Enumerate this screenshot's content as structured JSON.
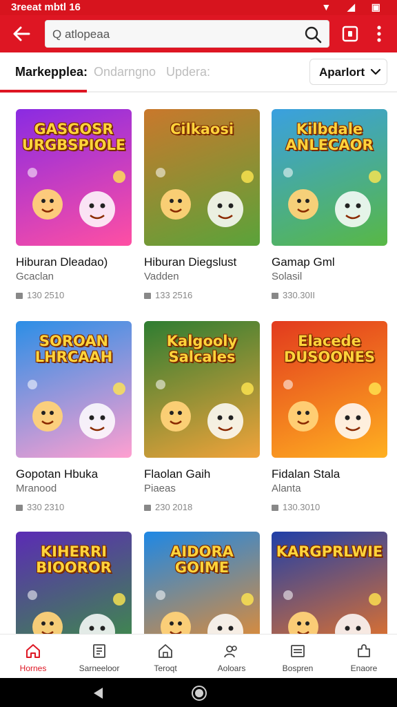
{
  "status_bar": {
    "time": "3reeat mbtl 16",
    "icons": "▼ ◢ ▣"
  },
  "search": {
    "value": "",
    "placeholder": "Q atlopeaa"
  },
  "tabs": [
    {
      "label": "Markepplea:",
      "active": true
    },
    {
      "label": "Ondarngno",
      "active": false
    },
    {
      "label": "Updera:",
      "active": false
    }
  ],
  "sort": {
    "label": "Aparlort"
  },
  "games": [
    {
      "art_title": "GASGOSR URGBSPIOLE",
      "title": "Hiburan Dleadao)",
      "subtitle": "Gcaclan",
      "meta": "130 2510",
      "palette": [
        "#8a2be2",
        "#ff4fa3"
      ]
    },
    {
      "art_title": "Cilkaosi",
      "title": "Hiburan Diegslust",
      "subtitle": "Vadden",
      "meta": "133 2516",
      "palette": [
        "#c9782c",
        "#5aa33a"
      ]
    },
    {
      "art_title": "Kilbdale ANLECAOR",
      "title": "Gamap Gml",
      "subtitle": "Solasil",
      "meta": "330.30II",
      "palette": [
        "#3aa0e0",
        "#58b845"
      ]
    },
    {
      "art_title": "SOROAN LHRCAAH",
      "title": "Gopotan Hbuka",
      "subtitle": "Mranood",
      "meta": "330 2310",
      "palette": [
        "#2b8ee6",
        "#ff9fd0"
      ]
    },
    {
      "art_title": "Kalgooly Salcales",
      "title": "Flaolan Gaih",
      "subtitle": "Piaeas",
      "meta": "230 2018",
      "palette": [
        "#2e7d32",
        "#f2a33a"
      ]
    },
    {
      "art_title": "Elacede DUSOONES",
      "title": "Fidalan Stala",
      "subtitle": "Alanta",
      "meta": "130.3010",
      "palette": [
        "#e23a1e",
        "#ffb020"
      ]
    },
    {
      "art_title": "KIHERRI BIOOROR",
      "title": "",
      "subtitle": "",
      "meta": "",
      "palette": [
        "#5b2bb5",
        "#3a9a3a"
      ]
    },
    {
      "art_title": "AIDORA GOIME",
      "title": "",
      "subtitle": "",
      "meta": "",
      "palette": [
        "#1e88e5",
        "#ff8c1a"
      ]
    },
    {
      "art_title": "KARGPRLWIE",
      "title": "",
      "subtitle": "",
      "meta": "",
      "palette": [
        "#1f3fa8",
        "#ff7a1a"
      ]
    }
  ],
  "bottom_nav": [
    {
      "label": "Hornes",
      "icon": "home-icon",
      "active": true
    },
    {
      "label": "Sarneeloor",
      "icon": "document-icon",
      "active": false
    },
    {
      "label": "Teroqt",
      "icon": "house-outline-icon",
      "active": false
    },
    {
      "label": "Aoloars",
      "icon": "people-icon",
      "active": false
    },
    {
      "label": "Bospren",
      "icon": "list-icon",
      "active": false
    },
    {
      "label": "Enaore",
      "icon": "puzzle-icon",
      "active": false
    }
  ],
  "colors": {
    "brand": "#de1623",
    "status_bar": "#d7141e"
  }
}
